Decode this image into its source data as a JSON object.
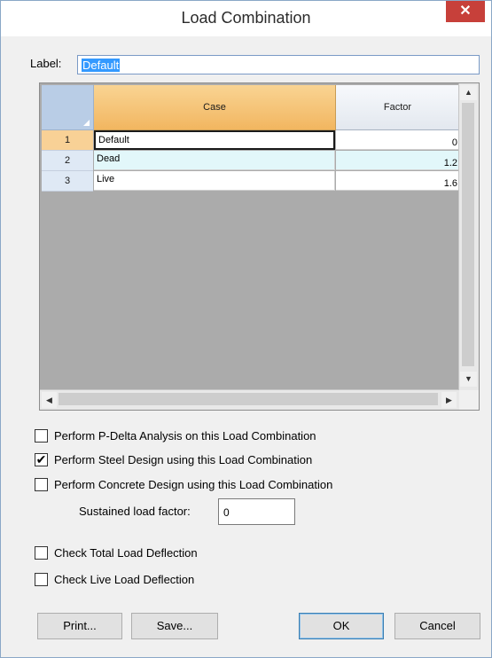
{
  "window": {
    "title": "Load Combination",
    "close_glyph": "✕"
  },
  "label_field": {
    "caption": "Label:",
    "value": "Default"
  },
  "grid": {
    "columns": [
      "Case",
      "Factor"
    ],
    "rows": [
      {
        "num": "1",
        "case": "Default",
        "factor": "0"
      },
      {
        "num": "2",
        "case": "Dead",
        "factor": "1.2"
      },
      {
        "num": "3",
        "case": "Live",
        "factor": "1.6"
      }
    ],
    "scroll": {
      "up": "▲",
      "down": "▼",
      "left": "◀",
      "right": "▶"
    }
  },
  "options": {
    "pdelta": {
      "label": "Perform P-Delta Analysis on this Load Combination",
      "checked": false
    },
    "steel": {
      "label": "Perform Steel Design using this Load Combination",
      "checked": true
    },
    "concrete": {
      "label": "Perform Concrete Design using this Load Combination",
      "checked": false
    },
    "total_defl": {
      "label": "Check Total Load Deflection",
      "checked": false
    },
    "live_defl": {
      "label": "Check Live Load Deflection",
      "checked": false
    },
    "check_glyph": "✔"
  },
  "sustained": {
    "label": "Sustained load factor:",
    "value": "0"
  },
  "buttons": {
    "print": "Print...",
    "save": "Save...",
    "ok": "OK",
    "cancel": "Cancel"
  },
  "colors": {
    "close_bg": "#c7403a",
    "header_active": "#f2b660",
    "selection": "#3399ff"
  }
}
